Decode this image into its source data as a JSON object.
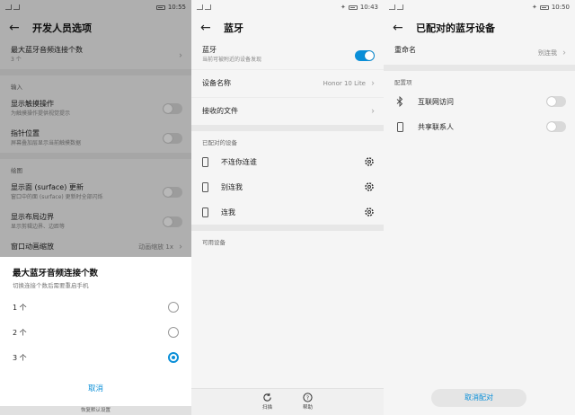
{
  "colors": {
    "accent": "#0a8fd8",
    "bg": "#f5f5f5"
  },
  "panel1": {
    "status": {
      "time": "10:55"
    },
    "title": "开发人员选项",
    "rows": [
      {
        "title": "最大蓝牙音频连接个数",
        "sub": "3 个"
      },
      {
        "section": "输入"
      },
      {
        "title": "显示触摸操作",
        "sub": "为触摸操作提供视觉提示",
        "toggle": false
      },
      {
        "title": "指针位置",
        "sub": "屏幕叠加层显示当前触摸数据",
        "toggle": false
      },
      {
        "section": "绘图"
      },
      {
        "title": "显示面 (surface) 更新",
        "sub": "窗口中的面 (surface) 更新时全部闪烁",
        "toggle": false
      },
      {
        "title": "显示布局边界",
        "sub": "显示剪辑边界、边距等",
        "toggle": false
      },
      {
        "title": "窗口动画缩放",
        "value": "动画缩放 1x"
      }
    ],
    "dialog": {
      "title": "最大蓝牙音频连接个数",
      "subtitle": "切换连接个数后需要重启手机",
      "options": [
        {
          "label": "1 个",
          "selected": false
        },
        {
          "label": "2 个",
          "selected": false
        },
        {
          "label": "3 个",
          "selected": true
        }
      ],
      "cancel": "取消",
      "bottom_text": "恢复默认设置"
    }
  },
  "panel2": {
    "status": {
      "time": "10:43"
    },
    "title": "蓝牙",
    "bt_title": "蓝牙",
    "bt_sub": "当前可被附近的设备发现",
    "bt_on": true,
    "device_name_label": "设备名称",
    "device_name_value": "Honor 10 Lite",
    "received_files": "接收的文件",
    "paired_section": "已配对的设备",
    "devices": [
      "不连你连谁",
      "别连我",
      "连我"
    ],
    "available_section": "可用设备",
    "bottom": {
      "scan": "扫描",
      "help": "帮助"
    }
  },
  "panel3": {
    "status": {
      "time": "10:50"
    },
    "title": "已配对的蓝牙设备",
    "rename_label": "重命名",
    "rename_value": "别连我",
    "config_section": "配置项",
    "options": [
      {
        "label": "互联网访问",
        "icon": "bluetooth-icon",
        "on": false
      },
      {
        "label": "共享联系人",
        "icon": "phone-icon",
        "on": false
      }
    ],
    "unpair": "取消配对"
  }
}
